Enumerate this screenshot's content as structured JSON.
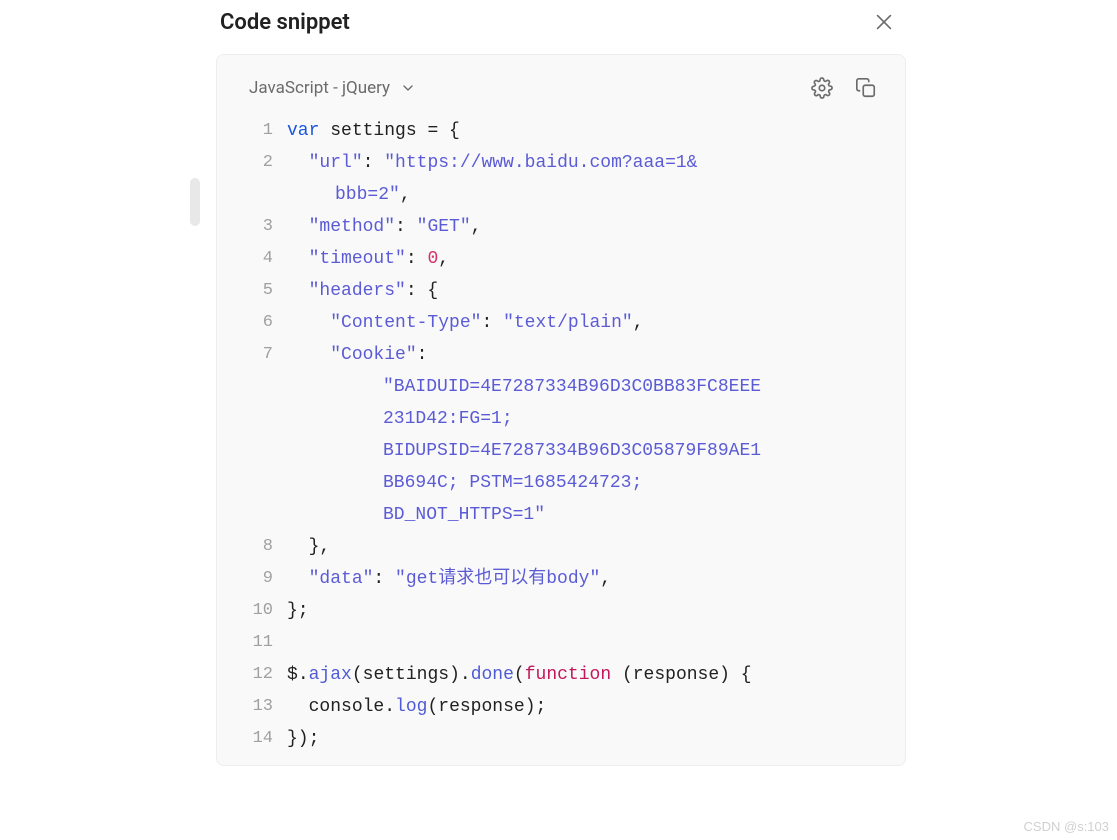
{
  "header": {
    "title": "Code snippet"
  },
  "language": {
    "label": "JavaScript - jQuery"
  },
  "code": {
    "lines": [
      {
        "n": "1",
        "tokens": [
          {
            "t": "var ",
            "c": "kw"
          },
          {
            "t": "settings ",
            "c": "id"
          },
          {
            "t": "= {",
            "c": "pun"
          }
        ]
      },
      {
        "n": "2",
        "tokens": [
          {
            "t": "  ",
            "c": "pun"
          },
          {
            "t": "\"url\"",
            "c": "str"
          },
          {
            "t": ": ",
            "c": "pun"
          },
          {
            "t": "\"https://www.baidu.com?aaa=1&",
            "c": "str"
          }
        ],
        "cont": [
          {
            "t": "bbb=2\"",
            "c": "str"
          },
          {
            "t": ",",
            "c": "pun"
          }
        ]
      },
      {
        "n": "3",
        "tokens": [
          {
            "t": "  ",
            "c": "pun"
          },
          {
            "t": "\"method\"",
            "c": "str"
          },
          {
            "t": ": ",
            "c": "pun"
          },
          {
            "t": "\"GET\"",
            "c": "str"
          },
          {
            "t": ",",
            "c": "pun"
          }
        ]
      },
      {
        "n": "4",
        "tokens": [
          {
            "t": "  ",
            "c": "pun"
          },
          {
            "t": "\"timeout\"",
            "c": "str"
          },
          {
            "t": ": ",
            "c": "pun"
          },
          {
            "t": "0",
            "c": "num"
          },
          {
            "t": ",",
            "c": "pun"
          }
        ]
      },
      {
        "n": "5",
        "tokens": [
          {
            "t": "  ",
            "c": "pun"
          },
          {
            "t": "\"headers\"",
            "c": "str"
          },
          {
            "t": ": {",
            "c": "pun"
          }
        ]
      },
      {
        "n": "6",
        "tokens": [
          {
            "t": "    ",
            "c": "pun"
          },
          {
            "t": "\"Content-Type\"",
            "c": "str"
          },
          {
            "t": ": ",
            "c": "pun"
          },
          {
            "t": "\"text/plain\"",
            "c": "str"
          },
          {
            "t": ",",
            "c": "pun"
          }
        ]
      },
      {
        "n": "7",
        "tokens": [
          {
            "t": "    ",
            "c": "pun"
          },
          {
            "t": "\"Cookie\"",
            "c": "str"
          },
          {
            "t": ":",
            "c": "pun"
          }
        ],
        "cont_lines": [
          [
            {
              "t": "\"BAIDUID=4E7287334B96D3C0BB83FC8EEE",
              "c": "str"
            }
          ],
          [
            {
              "t": "231D42:FG=1;",
              "c": "str"
            }
          ],
          [
            {
              "t": "BIDUPSID=4E7287334B96D3C05879F89AE1",
              "c": "str"
            }
          ],
          [
            {
              "t": "BB694C; PSTM=1685424723;",
              "c": "str"
            }
          ],
          [
            {
              "t": "BD_NOT_HTTPS=1\"",
              "c": "str"
            }
          ]
        ]
      },
      {
        "n": "8",
        "tokens": [
          {
            "t": "  },",
            "c": "pun"
          }
        ]
      },
      {
        "n": "9",
        "tokens": [
          {
            "t": "  ",
            "c": "pun"
          },
          {
            "t": "\"data\"",
            "c": "str"
          },
          {
            "t": ": ",
            "c": "pun"
          },
          {
            "t": "\"get请求也可以有body\"",
            "c": "str"
          },
          {
            "t": ",",
            "c": "pun"
          }
        ]
      },
      {
        "n": "10",
        "tokens": [
          {
            "t": "};",
            "c": "pun"
          }
        ]
      },
      {
        "n": "11",
        "tokens": [
          {
            "t": "",
            "c": "pun"
          }
        ]
      },
      {
        "n": "12",
        "tokens": [
          {
            "t": "$",
            "c": "id"
          },
          {
            "t": ".",
            "c": "pun"
          },
          {
            "t": "ajax",
            "c": "meth"
          },
          {
            "t": "(",
            "c": "pun"
          },
          {
            "t": "settings",
            "c": "id"
          },
          {
            "t": ").",
            "c": "pun"
          },
          {
            "t": "done",
            "c": "meth"
          },
          {
            "t": "(",
            "c": "pun"
          },
          {
            "t": "function",
            "c": "kw2"
          },
          {
            "t": " (",
            "c": "pun"
          },
          {
            "t": "response",
            "c": "id"
          },
          {
            "t": ") {",
            "c": "pun"
          }
        ]
      },
      {
        "n": "13",
        "tokens": [
          {
            "t": "  ",
            "c": "pun"
          },
          {
            "t": "console",
            "c": "id"
          },
          {
            "t": ".",
            "c": "pun"
          },
          {
            "t": "log",
            "c": "meth"
          },
          {
            "t": "(",
            "c": "pun"
          },
          {
            "t": "response",
            "c": "id"
          },
          {
            "t": ");",
            "c": "pun"
          }
        ]
      },
      {
        "n": "14",
        "tokens": [
          {
            "t": "});",
            "c": "pun"
          }
        ]
      }
    ]
  },
  "watermark": "CSDN @s:103"
}
